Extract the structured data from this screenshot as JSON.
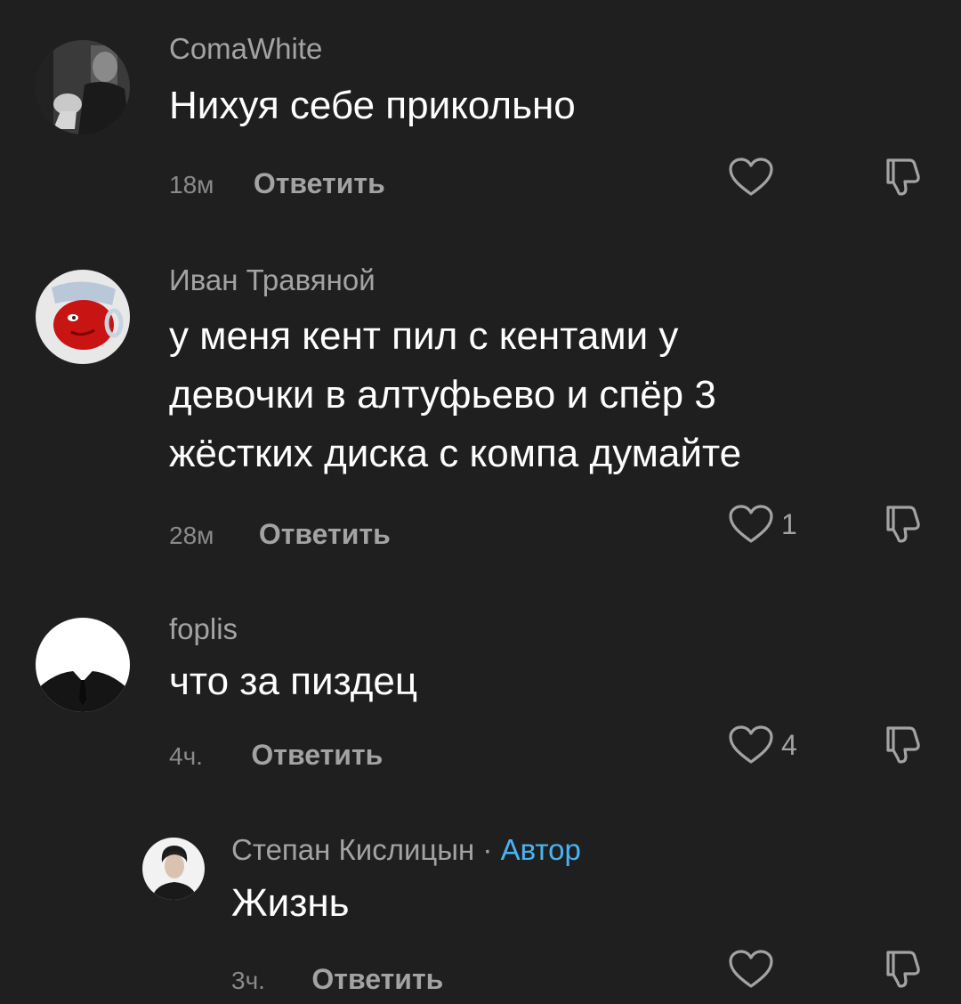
{
  "comments": [
    {
      "author": "ComaWhite",
      "text": "Нихуя себе прикольно",
      "time": "18м",
      "reply_label": "Ответить",
      "likes": "",
      "avatar_icon": "man-in-coat-avatar"
    },
    {
      "author": "Иван Травяной",
      "text": "у меня кент пил с кентами у\nдевочки в алтуфьево и спёр 3\nжёстких диска с компа думайте",
      "time": "28м",
      "reply_label": "Ответить",
      "likes": "1",
      "avatar_icon": "red-jug-avatar"
    },
    {
      "author": "foplis",
      "text": "что за пиздец",
      "time": "4ч.",
      "reply_label": "Ответить",
      "likes": "4",
      "avatar_icon": "faceless-suit-avatar"
    },
    {
      "author": "Степан Кислицын",
      "author_separator": "·",
      "author_badge": "Автор",
      "text": "Жизнь",
      "time": "3ч.",
      "reply_label": "Ответить",
      "likes": "",
      "avatar_icon": "young-man-avatar"
    }
  ],
  "colors": {
    "background": "#1f1f1f",
    "text": "#ffffff",
    "muted": "#a3a3a3",
    "badge": "#4ab3f4"
  },
  "icons": {
    "like": "heart-outline-icon",
    "dislike": "thumb-down-outline-icon"
  }
}
